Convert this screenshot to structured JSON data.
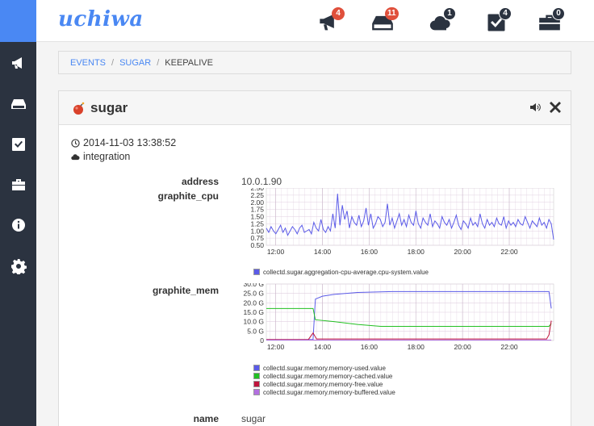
{
  "brand": "uchiwa",
  "nav_top": [
    {
      "icon": "megaphone-icon",
      "badge": "4",
      "badge_style": "red"
    },
    {
      "icon": "server-icon",
      "badge": "11",
      "badge_style": "red"
    },
    {
      "icon": "cloud-icon",
      "badge": "1",
      "badge_style": "dark"
    },
    {
      "icon": "checkbox-icon",
      "badge": "4",
      "badge_style": "dark"
    },
    {
      "icon": "briefcase-icon",
      "badge": "0",
      "badge_style": "dark"
    }
  ],
  "sidebar": [
    "megaphone-icon",
    "server-icon",
    "checkbox-icon",
    "briefcase-icon",
    "info-icon",
    "gear-icon"
  ],
  "breadcrumb": {
    "events": "EVENTS",
    "client": "SUGAR",
    "check": "KEEPALIVE"
  },
  "panel": {
    "title": "sugar",
    "timestamp": "2014-11-03 13:38:52",
    "datacenter": "integration"
  },
  "rows": {
    "address_label": "address",
    "address_value": "10.0.1.90",
    "cpu_label": "graphite_cpu",
    "mem_label": "graphite_mem",
    "name_label": "name",
    "name_value": "sugar"
  },
  "colors": {
    "accent": "#4a88f3",
    "sidebar": "#2b3340",
    "badge_red": "#e0503c"
  },
  "chart_data": [
    {
      "type": "line",
      "x_ticks": [
        "12:00",
        "14:00",
        "16:00",
        "18:00",
        "20:00",
        "22:00"
      ],
      "y_ticks": [
        "2.50",
        "2.25",
        "2.00",
        "1.75",
        "1.50",
        "1.25",
        "1.00",
        "0.75",
        "0.50"
      ],
      "ylim": [
        0.5,
        2.5
      ],
      "xlim_hours": [
        11.6,
        23.9
      ],
      "grid": true,
      "series": [
        {
          "name": "collectd.sugar.aggregation-cpu-average.cpu-system.value",
          "color": "#5b5be8",
          "values": [
            1.1,
            0.95,
            1.15,
            1.0,
            0.9,
            1.05,
            1.2,
            0.95,
            1.1,
            0.85,
            1.0,
            1.15,
            1.05,
            0.9,
            1.1,
            1.2,
            0.95,
            1.0,
            1.05,
            0.9,
            1.3,
            1.1,
            1.0,
            1.4,
            1.05,
            0.95,
            1.15,
            1.0,
            1.6,
            1.1,
            2.3,
            1.2,
            1.9,
            1.4,
            1.7,
            1.1,
            1.5,
            1.3,
            1.2,
            1.55,
            1.15,
            1.35,
            1.8,
            1.2,
            1.6,
            1.1,
            1.25,
            1.5,
            1.4,
            1.15,
            1.3,
            1.95,
            1.2,
            1.45,
            1.1,
            1.35,
            1.6,
            1.2,
            1.4,
            1.15,
            1.55,
            1.3,
            1.2,
            1.7,
            1.25,
            1.1,
            1.45,
            1.3,
            1.2,
            1.6,
            1.15,
            1.35,
            1.25,
            1.1,
            1.5,
            1.3,
            1.2,
            1.4,
            1.1,
            1.3,
            1.55,
            1.2,
            1.05,
            1.35,
            1.25,
            1.1,
            1.45,
            1.2,
            1.3,
            1.15,
            1.6,
            1.25,
            1.1,
            1.4,
            1.2,
            1.3,
            1.15,
            1.45,
            1.25,
            1.2,
            1.5,
            1.1,
            1.35,
            1.2,
            1.3,
            1.15,
            1.4,
            1.25,
            1.2,
            1.5,
            1.3,
            1.1,
            1.35,
            1.25,
            1.15,
            1.45,
            1.2,
            1.3,
            1.1,
            1.4,
            1.25,
            0.7
          ]
        }
      ]
    },
    {
      "type": "line",
      "x_ticks": [
        "12:00",
        "14:00",
        "16:00",
        "18:00",
        "20:00",
        "22:00"
      ],
      "y_ticks": [
        "30.0 G",
        "25.0 G",
        "20.0 G",
        "15.0 G",
        "10.0 G",
        "5.0 G",
        "0"
      ],
      "ylim": [
        0,
        30
      ],
      "xlim_hours": [
        11.6,
        23.9
      ],
      "grid": true,
      "series": [
        {
          "name": "collectd.sugar.memory.memory-used.value",
          "color": "#5b5be8",
          "points": [
            [
              11.6,
              0.5
            ],
            [
              13.6,
              0.5
            ],
            [
              13.7,
              22.0
            ],
            [
              14.0,
              23.5
            ],
            [
              14.5,
              24.5
            ],
            [
              15.5,
              25.5
            ],
            [
              17.0,
              26.0
            ],
            [
              23.7,
              26.0
            ],
            [
              23.8,
              17.0
            ]
          ]
        },
        {
          "name": "collectd.sugar.memory.memory-cached.value",
          "color": "#22c022",
          "points": [
            [
              11.6,
              17.0
            ],
            [
              13.6,
              17.0
            ],
            [
              13.7,
              11.0
            ],
            [
              14.5,
              10.0
            ],
            [
              15.5,
              8.5
            ],
            [
              16.5,
              7.5
            ],
            [
              23.7,
              7.5
            ],
            [
              23.8,
              9.0
            ]
          ]
        },
        {
          "name": "collectd.sugar.memory.memory-free.value",
          "color": "#c0143c",
          "points": [
            [
              11.6,
              0.5
            ],
            [
              13.4,
              0.5
            ],
            [
              13.6,
              4.0
            ],
            [
              13.75,
              0.8
            ],
            [
              23.6,
              0.8
            ],
            [
              23.7,
              3.0
            ],
            [
              23.8,
              10.5
            ]
          ]
        },
        {
          "name": "collectd.sugar.memory.memory-buffered.value",
          "color": "#b36fe0",
          "points": [
            [
              11.6,
              0.2
            ],
            [
              23.8,
              0.2
            ]
          ]
        }
      ]
    }
  ]
}
